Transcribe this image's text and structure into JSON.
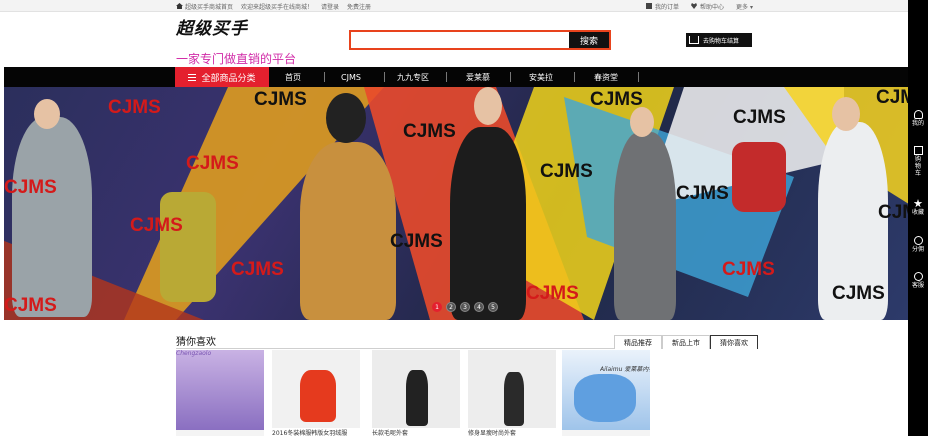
{
  "topbar": {
    "home": "超级买手商城首页",
    "welcome": "欢迎来超级买手在线商城！",
    "login": "请登录",
    "register": "免费注册",
    "orders": "我的订单",
    "help": "帮助中心",
    "more": "更多"
  },
  "header": {
    "logo": "超级买手",
    "slogan": "一家专门做直销的平台",
    "search_placeholder": "",
    "search_button": "搜索",
    "cart_button": "去购物车结算"
  },
  "nav": {
    "all_label": "全部商品分类",
    "items": [
      "首页",
      "CJMS",
      "九九专区",
      "爱莱慕",
      "安美拉",
      "春资堂"
    ]
  },
  "banner": {
    "watermark": "CJMS",
    "slides": [
      "1",
      "2",
      "3",
      "4",
      "5"
    ],
    "active_slide": 1
  },
  "sidebar": {
    "items": [
      "我的",
      "购物车",
      "收藏",
      "分佣",
      "客服"
    ]
  },
  "guess": {
    "title": "猜你喜欢",
    "tabs": [
      "精品推荐",
      "新品上市",
      "猜你喜欢"
    ],
    "active_tab": 2,
    "products": [
      {
        "caption": "Chengzaolo"
      },
      {
        "caption": "2016冬装棉服韩版女羽绒服"
      },
      {
        "caption": "长款毛呢外套"
      },
      {
        "caption": "修身显瘦时尚外套"
      },
      {
        "caption": "Ailaimu 爱莱慕内衣"
      }
    ]
  },
  "colors": {
    "accent_red": "#e4202e",
    "search_border": "#e8431d",
    "slogan": "#d12ba7",
    "nav_bg": "#050505"
  }
}
